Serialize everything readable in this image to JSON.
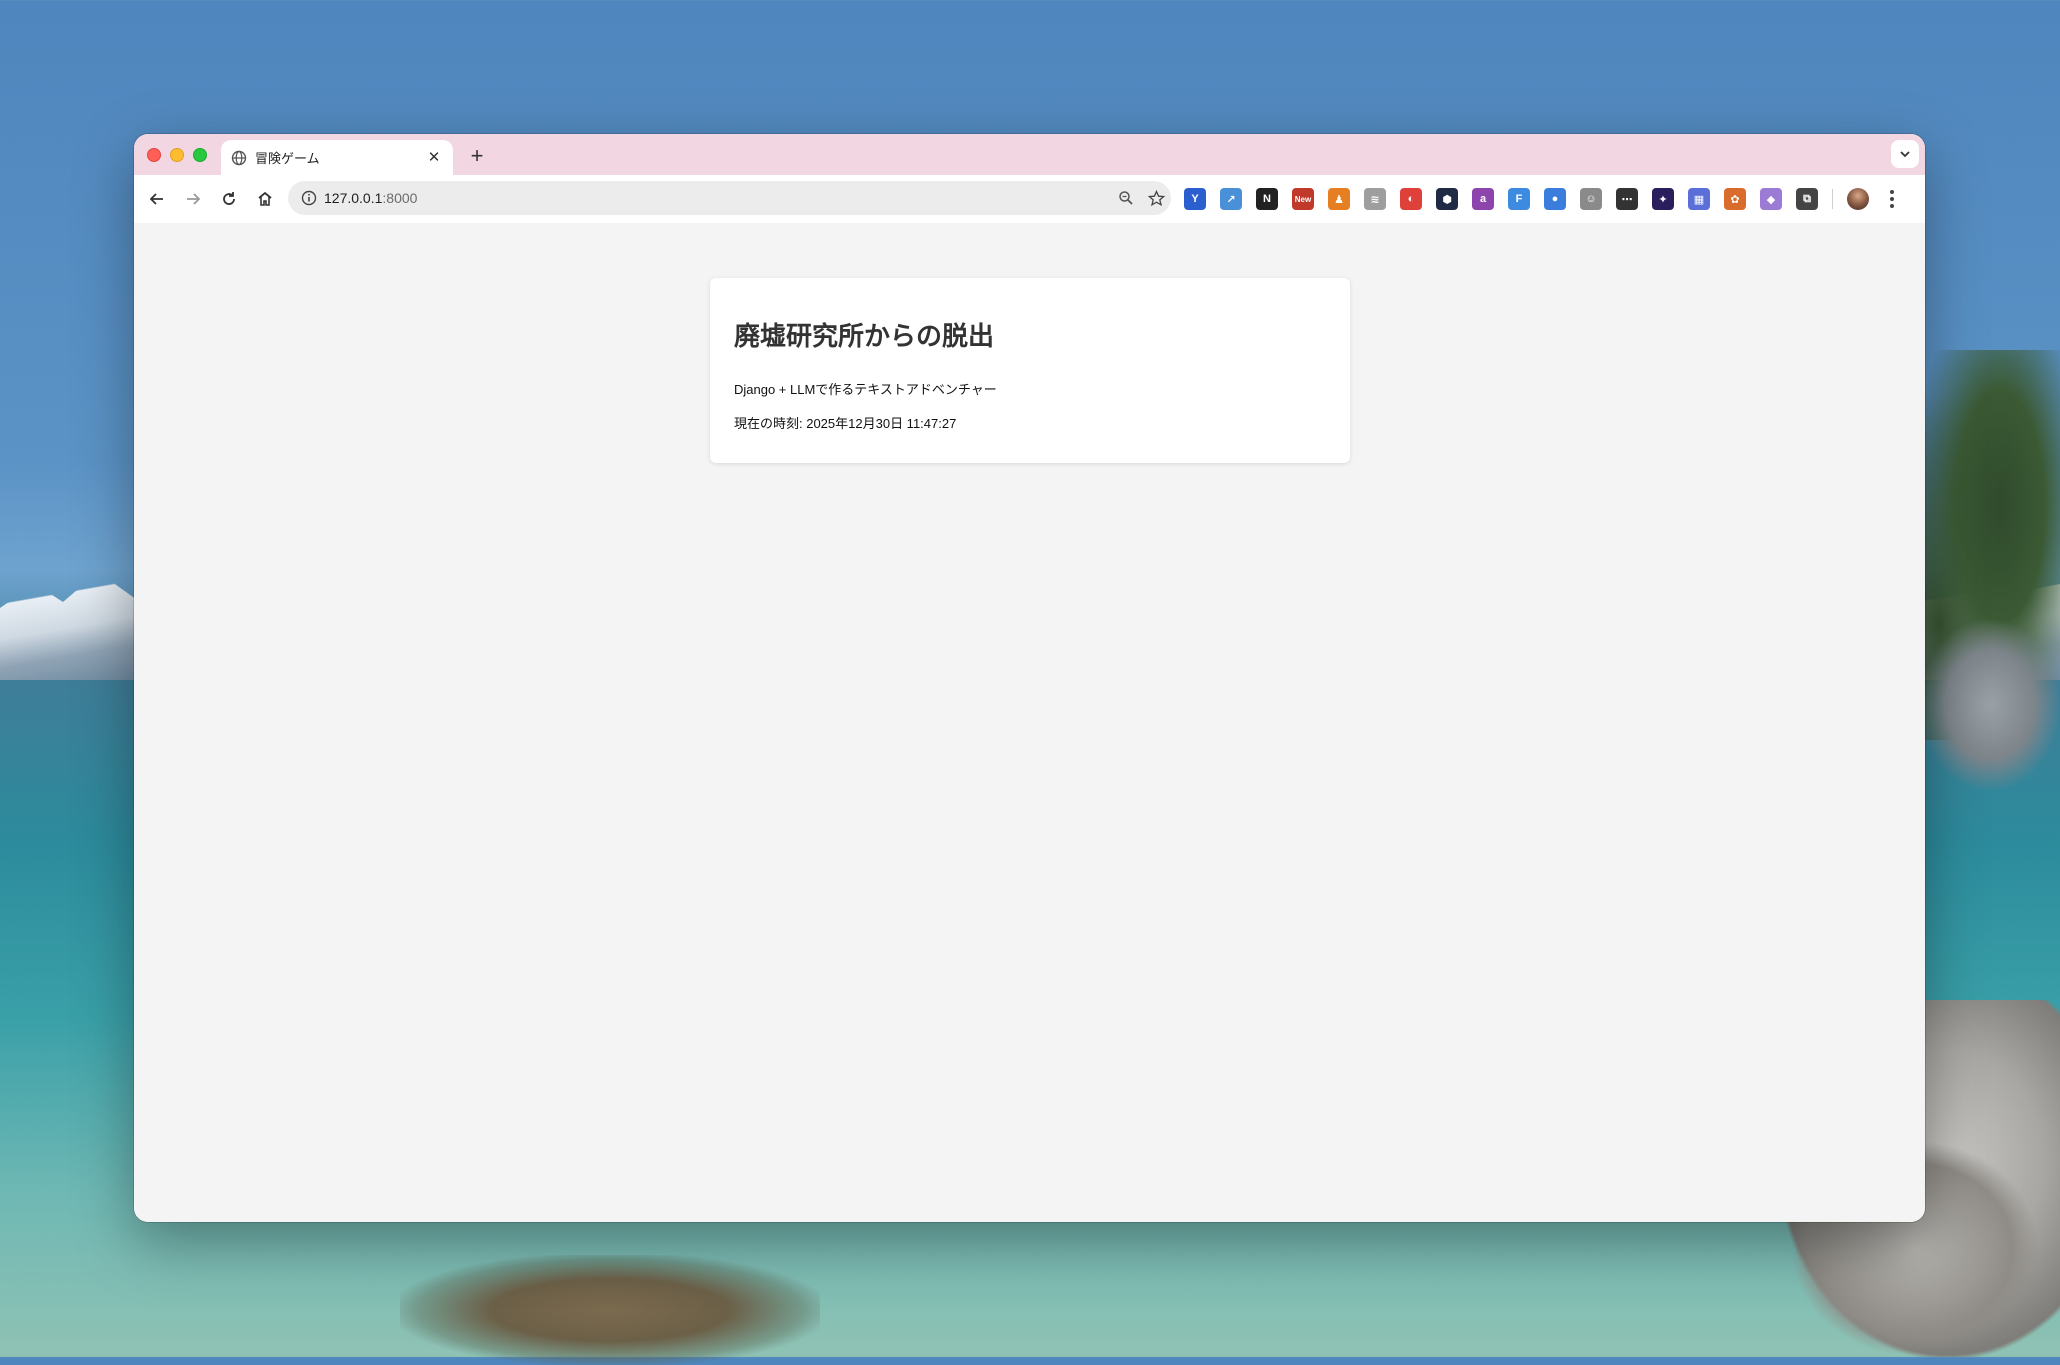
{
  "tab": {
    "title": "冒険ゲーム",
    "close": "✕"
  },
  "newtab_label": "+",
  "address": {
    "host": "127.0.0.1",
    "port": ":8000"
  },
  "extensions": [
    {
      "icon": "vivaldi-y-icon",
      "glyph": "Y",
      "color": "#2b5fd0"
    },
    {
      "icon": "share-icon",
      "glyph": "↗",
      "color": "#4a90d9"
    },
    {
      "icon": "notion-icon",
      "glyph": "N",
      "color": "#222222"
    },
    {
      "icon": "new-badge-icon",
      "glyph": "New",
      "color": "#c0392b"
    },
    {
      "icon": "person-icon",
      "glyph": "♟",
      "color": "#e67e22"
    },
    {
      "icon": "rss-icon",
      "glyph": "≋",
      "color": "#9e9e9e"
    },
    {
      "icon": "red-swirl-icon",
      "glyph": "◐",
      "color": "#e0403a"
    },
    {
      "icon": "hexagon-icon",
      "glyph": "⬢",
      "color": "#1f2a44"
    },
    {
      "icon": "purple-app-icon",
      "glyph": "a",
      "color": "#8e44ad"
    },
    {
      "icon": "f-app-icon",
      "glyph": "F",
      "color": "#3d8be0"
    },
    {
      "icon": "blue-circle-icon",
      "glyph": "●",
      "color": "#3b7ddd"
    },
    {
      "icon": "robot-icon",
      "glyph": "☺",
      "color": "#8a8a8a"
    },
    {
      "icon": "terminal-icon",
      "glyph": "⋯",
      "color": "#333333"
    },
    {
      "icon": "star-badge-icon",
      "glyph": "✦",
      "color": "#2a1f5c"
    },
    {
      "icon": "grid-app-icon",
      "glyph": "▦",
      "color": "#5a6fd8"
    },
    {
      "icon": "cat-icon",
      "glyph": "✿",
      "color": "#d96c2c"
    },
    {
      "icon": "crystal-icon",
      "glyph": "◆",
      "color": "#9b7bd4"
    },
    {
      "icon": "puzzle-icon",
      "glyph": "⧉",
      "color": "#444444"
    }
  ],
  "page": {
    "heading": "廃墟研究所からの脱出",
    "subtitle": "Django + LLMで作るテキストアドベンチャー",
    "time_label": "現在の時刻: 2025年12月30日 11:47:27"
  }
}
